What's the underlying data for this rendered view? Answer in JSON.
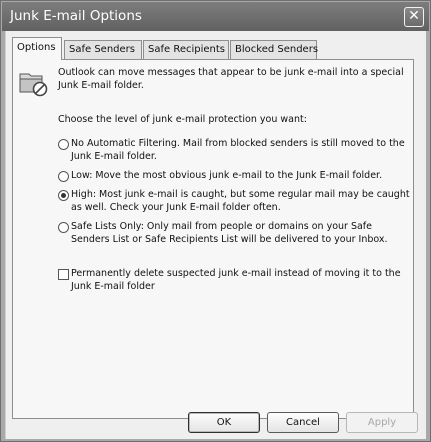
{
  "window": {
    "title": "Junk E-mail Options",
    "close_glyph": "✕"
  },
  "tabs": [
    {
      "label": "Options",
      "active": true
    },
    {
      "label": "Safe Senders",
      "active": false
    },
    {
      "label": "Safe Recipients",
      "active": false
    },
    {
      "label": "Blocked Senders",
      "active": false
    }
  ],
  "options": {
    "icon": "junk-folder-icon",
    "intro": "Outlook can move messages that appear to be junk e-mail into a special Junk E-mail folder.",
    "choose_label": "Choose the level of junk e-mail protection you want:",
    "levels": [
      {
        "label": "No Automatic Filtering.  Mail from blocked senders is still moved to the Junk E-mail folder.",
        "selected": false
      },
      {
        "label": "Low: Move the most obvious junk e-mail to the Junk E-mail folder.",
        "selected": false
      },
      {
        "label": "High: Most junk e-mail is caught, but some regular mail may be caught as well. Check your Junk E-mail folder often.",
        "selected": true
      },
      {
        "label": "Safe Lists Only: Only mail from people or domains on your Safe Senders List or Safe Recipients List will be delivered to your Inbox.",
        "selected": false
      }
    ],
    "delete_checkbox": {
      "label": "Permanently delete suspected junk e-mail instead of moving it to the Junk E-mail folder",
      "checked": false
    }
  },
  "buttons": {
    "ok": "OK",
    "cancel": "Cancel",
    "apply": "Apply"
  }
}
